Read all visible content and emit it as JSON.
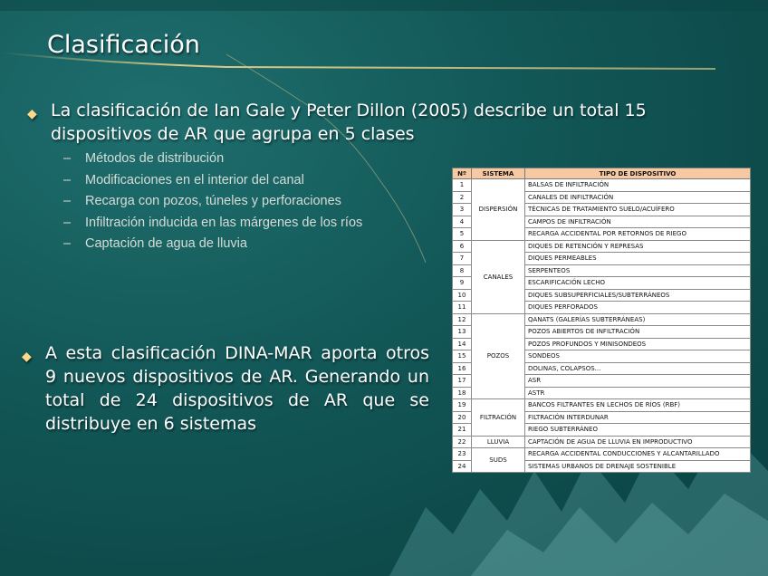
{
  "slide": {
    "title": "Clasificación",
    "bullet1": "La clasificación de Ian Gale y Peter Dillon (2005) describe un total 15 dispositivos de AR que agrupa en 5 clases",
    "subitems": [
      "Métodos de distribución",
      "Modificaciones en el interior del canal",
      "Recarga con pozos, túneles y perforaciones",
      "Infiltración inducida en las márgenes de los ríos",
      "Captación de agua de lluvia"
    ],
    "bullet2": "A esta clasificación DINA-MAR aporta otros 9 nuevos dispositivos  de AR. Generando un total de 24 dispositivos de AR que se distribuye en 6 sistemas"
  },
  "colors": {
    "table_header": "#f6c9a2",
    "bullet_mark": "#ffd88a"
  },
  "table": {
    "headers": [
      "Nº",
      "SISTEMA",
      "TIPO DE DISPOSITIVO"
    ],
    "rows": [
      {
        "n": "1",
        "d": "BALSAS DE INFILTRACIÓN"
      },
      {
        "n": "2",
        "d": "CANALES DE INFILTRACIÓN"
      },
      {
        "n": "3",
        "d": "TÉCNICAS DE TRATAMIENTO SUELO/ACUÍFERO"
      },
      {
        "n": "4",
        "d": "CAMPOS DE INFILTRACIÓN"
      },
      {
        "n": "5",
        "d": "RECARGA ACCIDENTAL POR RETORNOS DE RIEGO"
      },
      {
        "n": "6",
        "d": "DIQUES DE RETENCIÓN Y REPRESAS"
      },
      {
        "n": "7",
        "d": "DIQUES PERMEABLES"
      },
      {
        "n": "8",
        "d": "SERPENTEOS"
      },
      {
        "n": "9",
        "d": "ESCARIFICACIÓN LECHO"
      },
      {
        "n": "10",
        "d": "DIQUES SUBSUPERFICIALES/SUBTERRÁNEOS"
      },
      {
        "n": "11",
        "d": "DIQUES PERFORADOS"
      },
      {
        "n": "12",
        "d": "QANATS (GALERÍAS SUBTERRÁNEAS)"
      },
      {
        "n": "13",
        "d": "POZOS ABIERTOS DE INFILTRACIÓN"
      },
      {
        "n": "14",
        "d": "POZOS PROFUNDOS Y MINISONDEOS"
      },
      {
        "n": "15",
        "d": "SONDEOS"
      },
      {
        "n": "16",
        "d": "DOLINAS, COLAPSOS..."
      },
      {
        "n": "17",
        "d": "ASR"
      },
      {
        "n": "18",
        "d": "ASTR"
      },
      {
        "n": "19",
        "d": "BANCOS FILTRANTES EN LECHOS DE RÍOS (RBF)"
      },
      {
        "n": "20",
        "d": "FILTRACIÓN INTERDUNAR"
      },
      {
        "n": "21",
        "d": "RIEGO SUBTERRÁNEO"
      },
      {
        "n": "22",
        "d": "CAPTACIÓN DE AGUA DE LLUVIA EN IMPRODUCTIVO"
      },
      {
        "n": "23",
        "d": "RECARGA ACCIDENTAL CONDUCCIONES Y ALCANTARILLADO"
      },
      {
        "n": "24",
        "d": "SISTEMAS URBANOS DE DRENAJE SOSTENIBLE"
      }
    ],
    "systems": [
      {
        "name": "DISPERSIÓN",
        "start": 0,
        "span": 5
      },
      {
        "name": "CANALES",
        "start": 5,
        "span": 6
      },
      {
        "name": "POZOS",
        "start": 11,
        "span": 7
      },
      {
        "name": "FILTRACIÓN",
        "start": 18,
        "span": 3
      },
      {
        "name": "LLUVIA",
        "start": 21,
        "span": 1
      },
      {
        "name": "SUDS",
        "start": 22,
        "span": 2
      }
    ]
  }
}
